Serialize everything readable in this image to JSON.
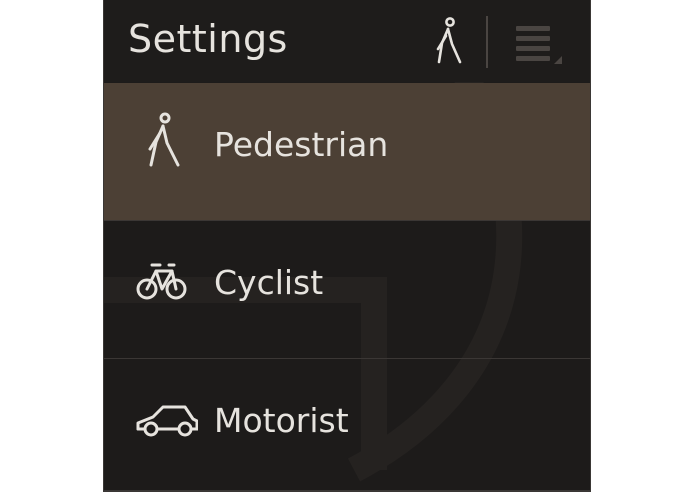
{
  "header": {
    "title": "Settings",
    "current_mode_icon": "pedestrian-icon",
    "menu_icon": "menu-icon"
  },
  "modes": [
    {
      "label": "Pedestrian",
      "icon": "pedestrian-icon",
      "selected": true
    },
    {
      "label": "Cyclist",
      "icon": "bicycle-icon",
      "selected": false
    },
    {
      "label": "Motorist",
      "icon": "car-icon",
      "selected": false
    }
  ],
  "colors": {
    "panel_background": "#1d1b1a",
    "selected_background": "#4c4035",
    "text": "#e6e3de",
    "separator": "#3b3735"
  }
}
